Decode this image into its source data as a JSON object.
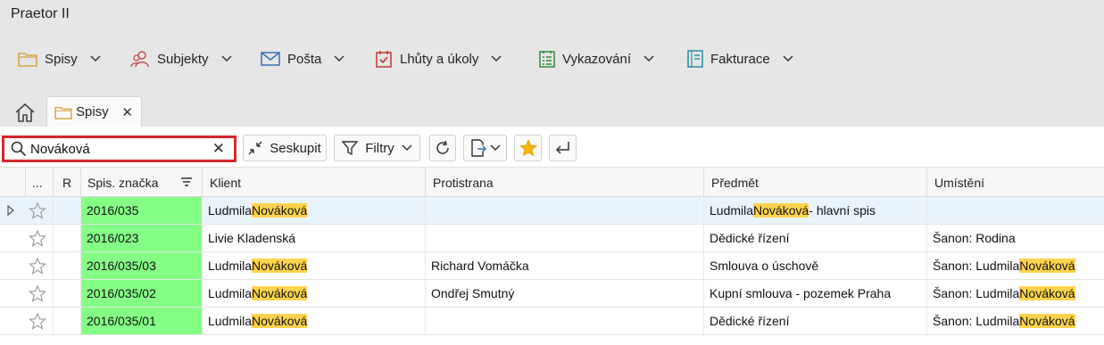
{
  "app": {
    "title": "Praetor II"
  },
  "menu": [
    {
      "label": "Spisy",
      "icon": "folder-icon",
      "color": "#d9a441"
    },
    {
      "label": "Subjekty",
      "icon": "people-icon",
      "color": "#c0504d"
    },
    {
      "label": "Pošta",
      "icon": "envelope-icon",
      "color": "#3a6fb5"
    },
    {
      "label": "Lhůty a úkoly",
      "icon": "calendar-check-icon",
      "color": "#c0392b"
    },
    {
      "label": "Vykazování",
      "icon": "checklist-icon",
      "color": "#2e8b3a"
    },
    {
      "label": "Fakturace",
      "icon": "invoice-icon",
      "color": "#2a8fa0"
    }
  ],
  "tabs": {
    "active_label": "Spisy"
  },
  "toolbar": {
    "search_value": "Nováková",
    "group_label": "Seskupit",
    "filter_label": "Filtry"
  },
  "grid": {
    "columns": {
      "more": "...",
      "r": "R",
      "spis": "Spis. značka",
      "klient": "Klient",
      "protistrana": "Protistrana",
      "predmet": "Předmět",
      "umisteni": "Umístění"
    },
    "highlight": "Nováková",
    "rows": [
      {
        "spis": "2016/035",
        "klient": [
          "Ludmila ",
          "Nováková"
        ],
        "protistrana": "",
        "predmet": [
          "Ludmila ",
          "Nováková",
          " - hlavní spis"
        ],
        "umisteni": [
          "",
          "",
          ""
        ],
        "selected": true
      },
      {
        "spis": "2016/023",
        "klient": [
          "Livie Kladenská",
          ""
        ],
        "protistrana": "",
        "predmet": [
          "Dědické řízení",
          "",
          ""
        ],
        "umisteni": [
          "Šanon: Rodina",
          "",
          ""
        ],
        "selected": false
      },
      {
        "spis": "2016/035/03",
        "klient": [
          "Ludmila ",
          "Nováková"
        ],
        "protistrana": "Richard Vomáčka",
        "predmet": [
          "Smlouva o úschově",
          "",
          ""
        ],
        "umisteni": [
          "Šanon: Ludmila ",
          "Nováková",
          ""
        ],
        "selected": false
      },
      {
        "spis": "2016/035/02",
        "klient": [
          "Ludmila ",
          "Nováková"
        ],
        "protistrana": "Ondřej Smutný",
        "predmet": [
          "Kupní smlouva - pozemek Praha",
          "",
          ""
        ],
        "umisteni": [
          "Šanon: Ludmila ",
          "Nováková",
          ""
        ],
        "selected": false
      },
      {
        "spis": "2016/035/01",
        "klient": [
          "Ludmila ",
          "Nováková"
        ],
        "protistrana": "",
        "predmet": [
          "Dědické řízení",
          "",
          ""
        ],
        "umisteni": [
          "Šanon: Ludmila ",
          "Nováková",
          ""
        ],
        "selected": false
      }
    ]
  }
}
